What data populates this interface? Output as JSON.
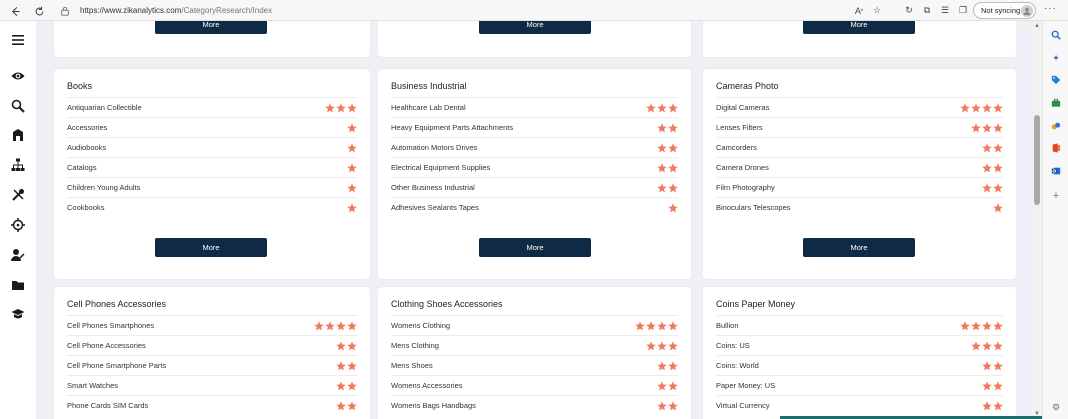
{
  "browser": {
    "url_domain": "https://www.zikanalytics.com",
    "url_path": "/CategoryResearch/Index",
    "sync_label": "Not syncing"
  },
  "top_more_label": "More",
  "cards": [
    {
      "title": "Books",
      "more_label": "More",
      "items": [
        {
          "name": "Antiquarian Collectible",
          "stars": 3
        },
        {
          "name": "Accessories",
          "stars": 1
        },
        {
          "name": "Audiobooks",
          "stars": 1
        },
        {
          "name": "Catalogs",
          "stars": 1
        },
        {
          "name": "Children Young Adults",
          "stars": 1
        },
        {
          "name": "Cookbooks",
          "stars": 1
        }
      ]
    },
    {
      "title": "Business Industrial",
      "more_label": "More",
      "items": [
        {
          "name": "Healthcare Lab Dental",
          "stars": 3
        },
        {
          "name": "Heavy Equipment Parts Attachments",
          "stars": 2
        },
        {
          "name": "Automation Motors Drives",
          "stars": 2
        },
        {
          "name": "Electrical Equipment Supplies",
          "stars": 2
        },
        {
          "name": "Other Business Industrial",
          "stars": 2
        },
        {
          "name": "Adhesives Sealants Tapes",
          "stars": 1
        }
      ]
    },
    {
      "title": "Cameras Photo",
      "more_label": "More",
      "items": [
        {
          "name": "Digital Cameras",
          "stars": 4
        },
        {
          "name": "Lenses Filters",
          "stars": 3
        },
        {
          "name": "Camcorders",
          "stars": 2
        },
        {
          "name": "Camera Drones",
          "stars": 2
        },
        {
          "name": "Film Photography",
          "stars": 2
        },
        {
          "name": "Binoculars Telescopes",
          "stars": 1
        }
      ]
    },
    {
      "title": "Cell Phones Accessories",
      "items": [
        {
          "name": "Cell Phones Smartphones",
          "stars": 4
        },
        {
          "name": "Cell Phone Accessories",
          "stars": 2
        },
        {
          "name": "Cell Phone Smartphone Parts",
          "stars": 2
        },
        {
          "name": "Smart Watches",
          "stars": 2
        },
        {
          "name": "Phone Cards SIM Cards",
          "stars": 2
        }
      ]
    },
    {
      "title": "Clothing Shoes Accessories",
      "items": [
        {
          "name": "Womens Clothing",
          "stars": 4
        },
        {
          "name": "Mens Clothing",
          "stars": 3
        },
        {
          "name": "Mens Shoes",
          "stars": 2
        },
        {
          "name": "Womens Accessories",
          "stars": 2
        },
        {
          "name": "Womens Bags Handbags",
          "stars": 2
        }
      ]
    },
    {
      "title": "Coins Paper Money",
      "items": [
        {
          "name": "Bullion",
          "stars": 4
        },
        {
          "name": "Coins: US",
          "stars": 3
        },
        {
          "name": "Coins: World",
          "stars": 2
        },
        {
          "name": "Paper Money: US",
          "stars": 2
        },
        {
          "name": "Virtual Currency",
          "stars": 2
        }
      ]
    }
  ],
  "colors": {
    "star": "#f07a5f",
    "button": "#0f2a44",
    "background": "#eff0f5"
  }
}
